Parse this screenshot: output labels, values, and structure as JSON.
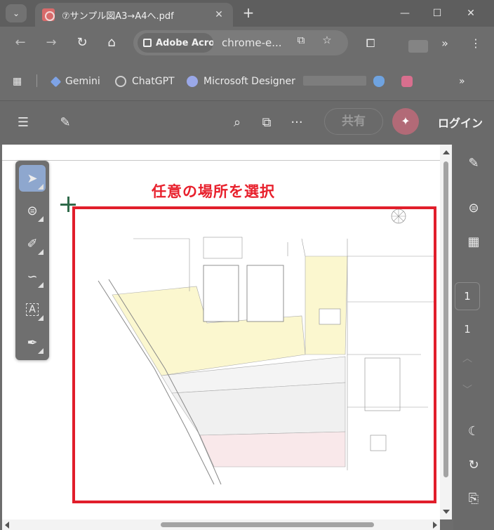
{
  "browser": {
    "tab_title": "⑦サンプル図A3→A4へ.pdf",
    "tab_close": "✕",
    "new_tab": "+",
    "tab_search_icon": "⌄",
    "window_controls": {
      "minimize": "—",
      "maximize": "☐",
      "close": "✕"
    },
    "nav": {
      "back": "←",
      "forward": "→",
      "reload": "↻",
      "home": "⌂"
    },
    "site_chip": "Adobe Acro",
    "url": "chrome-e...",
    "omnibox_icons": {
      "translate": "⧉",
      "bookmark": "☆"
    },
    "extensions": {
      "puzzle": "⧠",
      "more": "»",
      "menu": "⋮"
    }
  },
  "bookmarks": {
    "apps_icon": "▦",
    "items": [
      {
        "label": "Gemini",
        "color": "#7ea3e6"
      },
      {
        "label": "ChatGPT",
        "color": "#cfcfcf"
      },
      {
        "label": "Microsoft Designer",
        "color": "#9aa8e8"
      }
    ],
    "more": "»"
  },
  "acrobat": {
    "menu_icon": "☰",
    "ai_create_icon": "✎",
    "search_icon": "⌕",
    "pages_icon": "⧉",
    "more_icon": "···",
    "share_label": "共有",
    "login_label": "ログイン",
    "ai_icon": "✦"
  },
  "document": {
    "annotation": "任意の場所を選択",
    "selection_color": "#e11e2b"
  },
  "tools": [
    {
      "name": "select-tool",
      "glyph": "➤"
    },
    {
      "name": "comment-tool",
      "glyph": "⊜"
    },
    {
      "name": "highlight-tool",
      "glyph": "✐"
    },
    {
      "name": "draw-tool",
      "glyph": "∽"
    },
    {
      "name": "text-tool",
      "glyph": "A"
    },
    {
      "name": "sign-tool",
      "glyph": "✒"
    }
  ],
  "right_rail": {
    "page_current": "1",
    "page_total": "1",
    "up": "︿",
    "down": "﹀"
  }
}
